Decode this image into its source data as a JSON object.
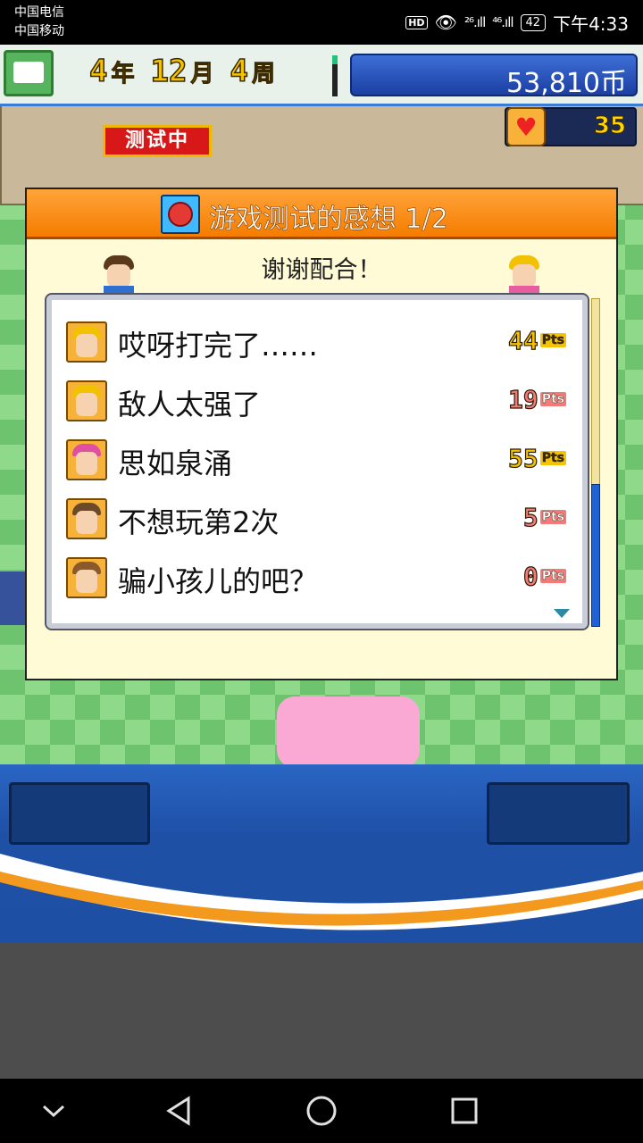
{
  "status_bar": {
    "carrier1": "中国电信",
    "carrier2": "中国移动",
    "hd": "HD",
    "signal1": "²⁶.ıll",
    "signal2": "⁴⁶.ıll",
    "battery": "42",
    "time": "下午4:33"
  },
  "hud": {
    "year_num": "4",
    "year_unit": "年",
    "month_num": "12",
    "month_unit": "月",
    "week_num": "4",
    "week_unit": "周",
    "money": "53,810币",
    "hearts": "35",
    "testing_label": "测试中"
  },
  "dialog": {
    "title": "游戏测试的感想 1/2",
    "thanks": "谢谢配合！",
    "rows": [
      {
        "comment": "哎呀打完了……",
        "score": "44",
        "unit": "Pts",
        "tone": "good",
        "hair": "#f2c100"
      },
      {
        "comment": "敌人太强了",
        "score": "19",
        "unit": "Pts",
        "tone": "bad",
        "hair": "#f2c100"
      },
      {
        "comment": "思如泉涌",
        "score": "55",
        "unit": "Pts",
        "tone": "good",
        "hair": "#e04fa0"
      },
      {
        "comment": "不想玩第2次",
        "score": "5",
        "unit": "Pts",
        "tone": "bad",
        "hair": "#6b4a2a"
      },
      {
        "comment": "骗小孩儿的吧？",
        "score": "0",
        "unit": "Pts",
        "tone": "bad",
        "hair": "#8a5a2a"
      }
    ]
  },
  "colors": {
    "dialog_header": "#f57c00",
    "money_panel": "#1c3fa3",
    "good_score": "#f5c400",
    "bad_score": "#f47a7a"
  },
  "icons": {
    "calendar": "calendar-icon",
    "heart": "heart-icon",
    "drum": "drumstick-icon",
    "back": "back-triangle-icon",
    "home": "home-circle-icon",
    "recents": "recents-square-icon",
    "down": "chevron-down-icon"
  }
}
